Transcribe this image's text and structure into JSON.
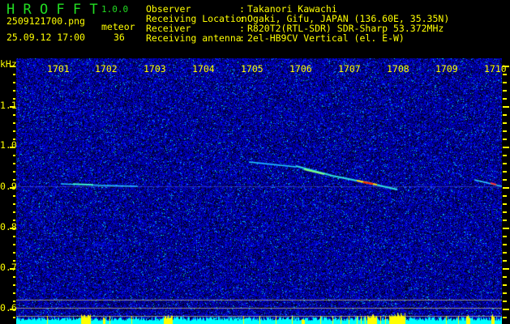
{
  "app": {
    "name": "H R O F F T",
    "version": "1.0.0"
  },
  "file": {
    "name": "2509121700.png",
    "datetime": "25.09.12 17:00"
  },
  "detection": {
    "label": "meteor",
    "count": "36"
  },
  "info": [
    {
      "label": "Observer",
      "value": "Takanori Kawachi"
    },
    {
      "label": "Receiving Location",
      "value": "Ogaki, Gifu, JAPAN (136.60E, 35.35N)"
    },
    {
      "label": "Receiver",
      "value": "R820T2(RTL-SDR) SDR-Sharp 53.372MHz"
    },
    {
      "label": "Receiving antenna",
      "value": "2el-HB9CV Vertical (el. E-W)"
    }
  ],
  "axis": {
    "y_unit": "kHz",
    "x_labels": [
      "1701",
      "1702",
      "1703",
      "1704",
      "1705",
      "1706",
      "1707",
      "1708",
      "1709",
      "1710"
    ],
    "y_labels": [
      "1.1",
      "1.0",
      "0.9",
      "0.8",
      "0.7",
      "0.6"
    ]
  },
  "colors": {
    "background": "#000000",
    "text": "#ffff00",
    "title": "#22dd22",
    "noise": "#1a1ad0",
    "baseline": "#00ffff",
    "signal_peak": "#ff0000"
  }
}
